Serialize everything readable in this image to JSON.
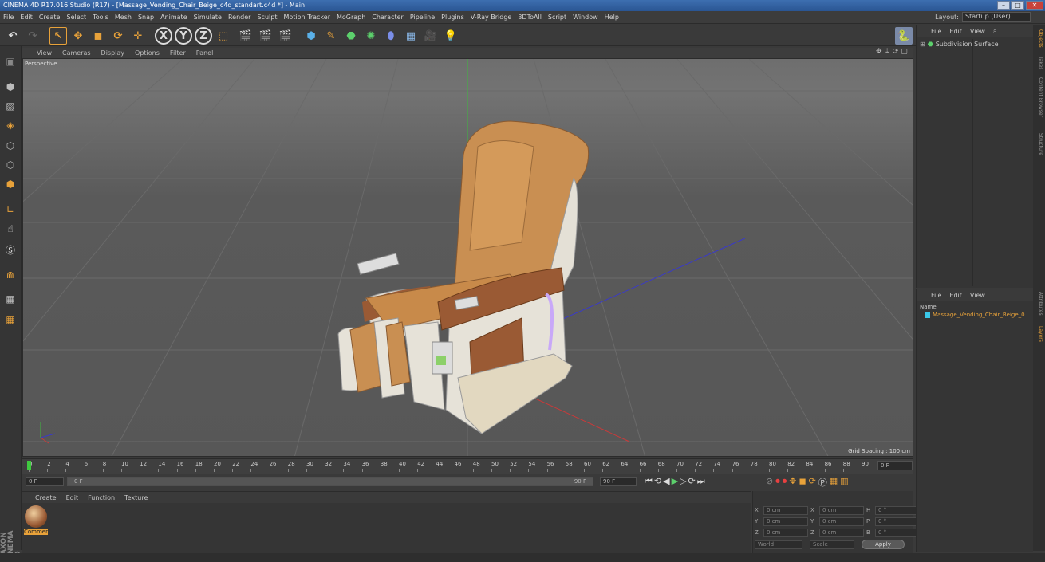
{
  "window": {
    "title": "CINEMA 4D R17.016 Studio (R17) - [Massage_Vending_Chair_Beige_c4d_standart.c4d *] - Main"
  },
  "menu": [
    "File",
    "Edit",
    "Create",
    "Select",
    "Tools",
    "Mesh",
    "Snap",
    "Animate",
    "Simulate",
    "Render",
    "Sculpt",
    "Motion Tracker",
    "MoGraph",
    "Character",
    "Pipeline",
    "Plugins",
    "V-Ray Bridge",
    "3DToAll",
    "Script",
    "Window",
    "Help"
  ],
  "layout": {
    "label": "Layout:",
    "value": "Startup (User)"
  },
  "viewport": {
    "menu": [
      "View",
      "Cameras",
      "Display",
      "Options",
      "Filter",
      "Panel"
    ],
    "label": "Perspective",
    "grid_spacing": "Grid Spacing : 100 cm"
  },
  "timeline": {
    "ticks": [
      "0",
      "2",
      "4",
      "6",
      "8",
      "10",
      "12",
      "14",
      "16",
      "18",
      "20",
      "22",
      "24",
      "26",
      "28",
      "30",
      "32",
      "34",
      "36",
      "38",
      "40",
      "42",
      "44",
      "46",
      "48",
      "50",
      "52",
      "54",
      "56",
      "58",
      "60",
      "62",
      "64",
      "66",
      "68",
      "70",
      "72",
      "74",
      "76",
      "78",
      "80",
      "82",
      "84",
      "86",
      "88",
      "90"
    ],
    "frame_end_field": "0 F"
  },
  "transport": {
    "current": "0 F",
    "slider_start": "0 F",
    "slider_end": "90 F",
    "end": "90 F"
  },
  "materials": {
    "menu": [
      "Create",
      "Edit",
      "Function",
      "Texture"
    ],
    "items": [
      {
        "name": "Commer"
      }
    ]
  },
  "coords": {
    "x": "0 cm",
    "y": "0 cm",
    "z": "0 cm",
    "x2": "0 cm",
    "y2": "0 cm",
    "z2": "0 cm",
    "h": "0 °",
    "p": "0 °",
    "b": "0 °",
    "space": "World",
    "mode": "Scale",
    "apply": "Apply",
    "axes": {
      "X": "X",
      "Y": "Y",
      "Z": "Z",
      "H": "H",
      "P": "P",
      "B": "B"
    }
  },
  "objects": {
    "menu": [
      "File",
      "Edit",
      "View"
    ],
    "items": [
      {
        "name": "Subdivision Surface"
      }
    ]
  },
  "layers": {
    "menu": [
      "File",
      "Edit",
      "View"
    ],
    "header": "Name",
    "items": [
      {
        "name": "Massage_Vending_Chair_Beige_0"
      }
    ]
  },
  "side_tabs": [
    "Objects",
    "Takes",
    "Content Browser",
    "Structure"
  ],
  "side_tabs2": [
    "Attributes",
    "Layers"
  ],
  "brand": "MAXON CINEMA 4D",
  "colors": {
    "accent": "#e8a23a",
    "title": "#2d5a9a",
    "chair_tan": "#d0944f",
    "chair_wood": "#9a5a34",
    "chair_white": "#e6e2d8"
  }
}
